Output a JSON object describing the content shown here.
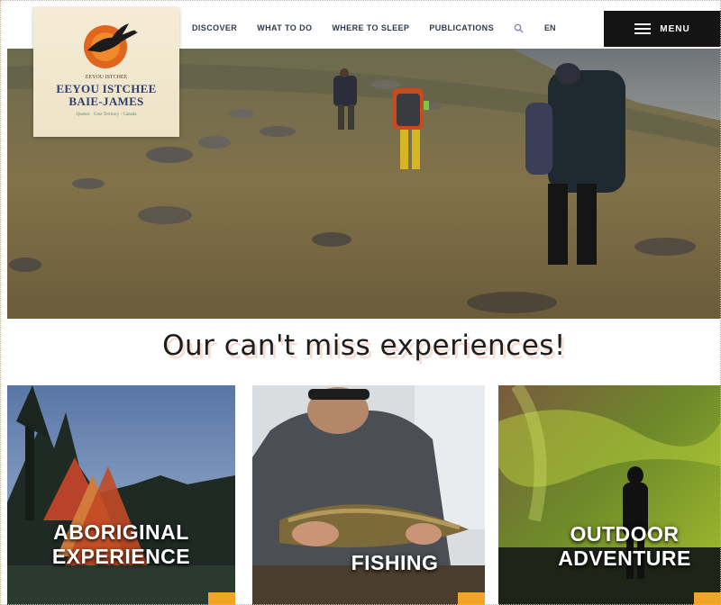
{
  "nav": {
    "links": [
      "DISCOVER",
      "WHAT TO DO",
      "WHERE TO SLEEP",
      "PUBLICATIONS"
    ],
    "search_icon": "search-icon",
    "lang": "EN",
    "menu_label": "MENU",
    "menu_icon": "hamburger-icon"
  },
  "logo": {
    "top_text": "EEYOU ISTCHEE",
    "name_line1": "EEYOU ISTCHEE",
    "name_line2": "BAIE-JAMES",
    "tagline": "Quebec · Cree Territory · Canada",
    "emblem": "goose-sun-emblem"
  },
  "hero": {
    "image": "hikers-on-tundra-photo"
  },
  "headline": "Our can't miss experiences!",
  "cards": [
    {
      "line1": "ABORIGINAL",
      "line2": "EXPERIENCE",
      "image": "teepee-forest-photo"
    },
    {
      "line1": "FISHING",
      "line2": "",
      "image": "fisherman-with-fish-photo"
    },
    {
      "line1": "OUTDOOR",
      "line2": "ADVENTURE",
      "image": "northern-lights-silhouette-photo"
    }
  ],
  "colors": {
    "accent": "#f2a427",
    "menu_bg": "#141414",
    "logo_blue": "#2d3f6e"
  }
}
